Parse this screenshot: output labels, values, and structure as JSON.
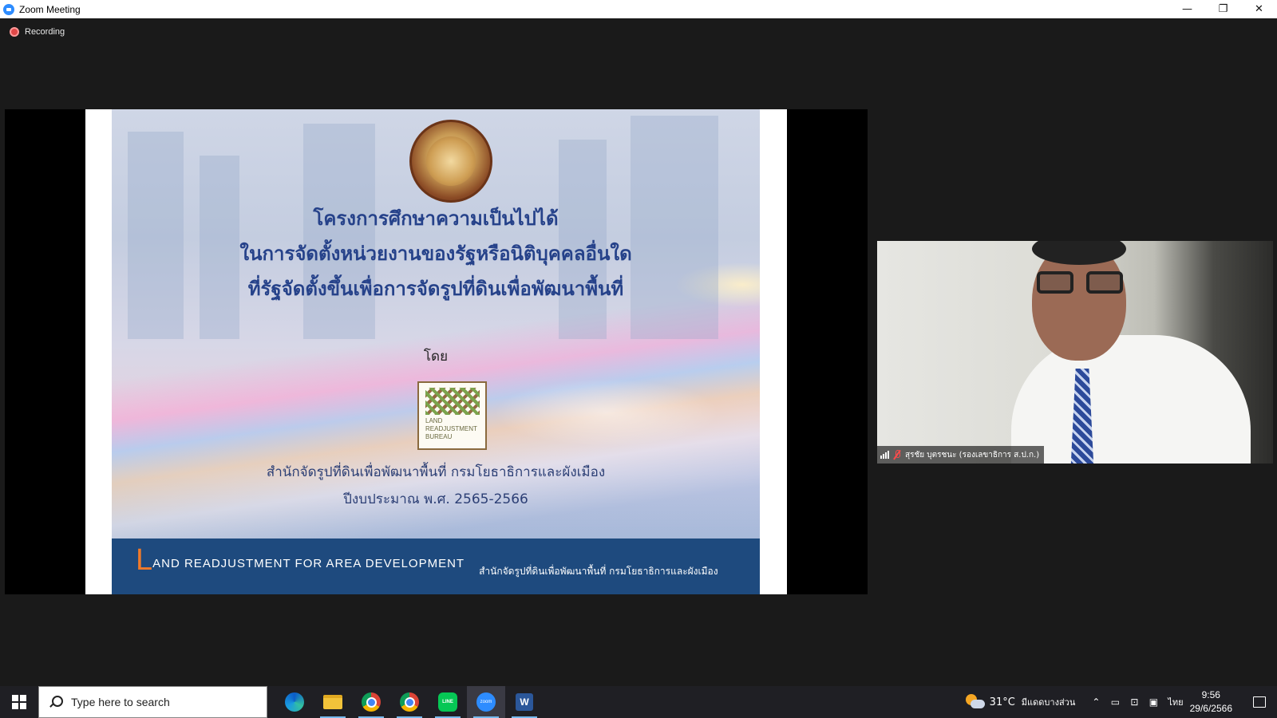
{
  "window": {
    "title": "Zoom Meeting",
    "controls": {
      "minimize": "—",
      "restore": "❐",
      "close": "✕"
    }
  },
  "recording": {
    "label": "Recording",
    "color": "#e04848"
  },
  "slide": {
    "title_lines": [
      "โครงการศึกษาความเป็นไปได้",
      "ในการจัดตั้งหน่วยงานของรัฐหรือนิติบุคคลอื่นใด",
      "ที่รัฐจัดตั้งขึ้นเพื่อการจัดรูปที่ดินเพื่อพัฒนาพื้นที่"
    ],
    "by": "โดย",
    "logo_text": [
      "LAND",
      "READJUSTMENT",
      "BUREAU"
    ],
    "org": "สำนักจัดรูปที่ดินเพื่อพัฒนาพื้นที่ กรมโยธาธิการและผังเมือง",
    "fiscal_year": "ปีงบประมาณ พ.ศ. 2565-2566",
    "band": {
      "initial": "L",
      "english": "AND READJUSTMENT FOR AREA DEVELOPMENT",
      "thai": "สำนักจัดรูปที่ดินเพื่อพัฒนาพื้นที่  กรมโยธาธิการและผังเมือง",
      "color": "#1e4a7e",
      "accent": "#f07a2a"
    }
  },
  "participant": {
    "name": "สุรชัย บุตรชนะ (รองเลขาธิการ ส.ป.ก.)",
    "mic": "muted-mic-icon"
  },
  "taskbar": {
    "search_placeholder": "Type here to search",
    "apps": [
      {
        "name": "edge-icon"
      },
      {
        "name": "file-explorer-icon"
      },
      {
        "name": "chrome-icon"
      },
      {
        "name": "chrome-icon"
      },
      {
        "name": "line-icon",
        "label": "LINE"
      },
      {
        "name": "zoom-icon",
        "label": "zoom"
      },
      {
        "name": "word-icon",
        "label": "W"
      }
    ],
    "weather": {
      "temp": "31°C",
      "condition": "มีแดดบางส่วน"
    },
    "language": "ไทย",
    "time": "9:56",
    "date": "29/6/2566"
  }
}
